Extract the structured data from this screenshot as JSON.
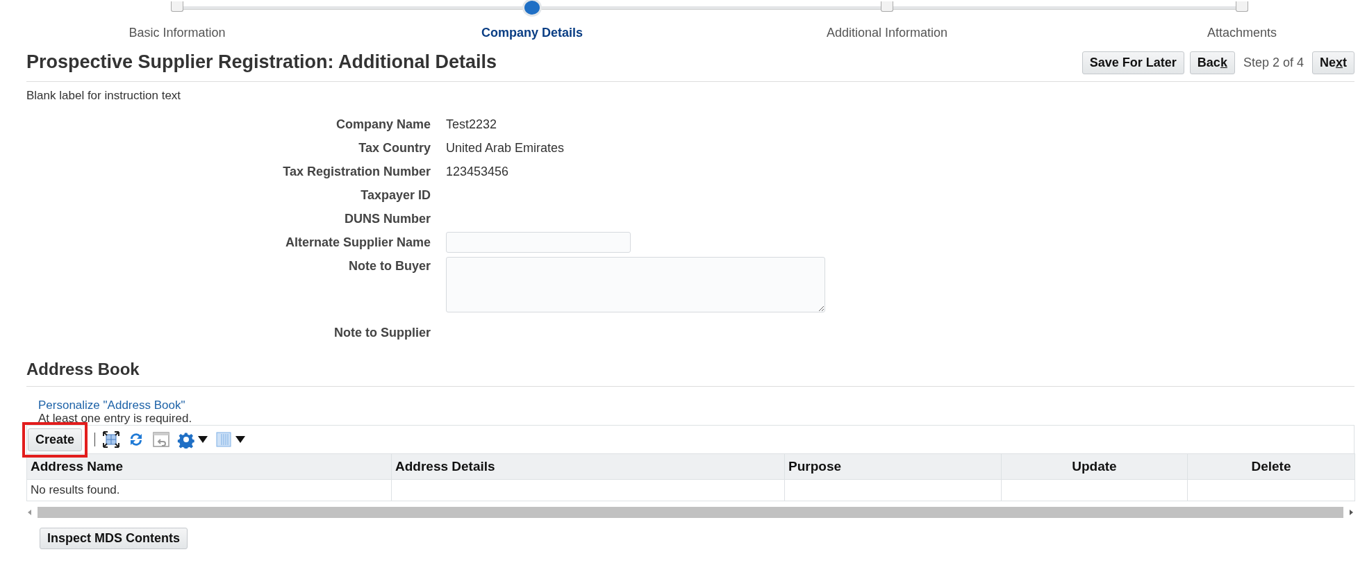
{
  "wizard": {
    "steps": [
      {
        "label": "Basic Information",
        "selected": false
      },
      {
        "label": "Company Details",
        "selected": true
      },
      {
        "label": "Additional Information",
        "selected": false
      },
      {
        "label": "Attachments",
        "selected": false
      }
    ]
  },
  "page_title": "Prospective Supplier Registration: Additional Details",
  "header_actions": {
    "save": {
      "text": "Save For Later"
    },
    "back": {
      "text": "Bac",
      "mnemonic": "k"
    },
    "step_info": "Step 2 of 4",
    "next": {
      "text": "Ne",
      "mnemonic": "x",
      "rest": "t"
    }
  },
  "instruction": "Blank label for instruction text",
  "fields": [
    {
      "kind": "text",
      "label": "Company Name",
      "value": "Test2232"
    },
    {
      "kind": "text",
      "label": "Tax Country",
      "value": "United Arab Emirates"
    },
    {
      "kind": "text",
      "label": "Tax Registration Number",
      "value": "123453456"
    },
    {
      "kind": "text",
      "label": "Taxpayer ID"
    },
    {
      "kind": "text",
      "label": "DUNS Number"
    },
    {
      "kind": "input",
      "label": "Alternate Supplier Name"
    },
    {
      "kind": "textarea",
      "label": "Note to Buyer"
    },
    {
      "kind": "text",
      "label": "Note to Supplier"
    }
  ],
  "address_book": {
    "heading": "Address Book",
    "personalize_link": "Personalize \"Address Book\"",
    "required_note": "At least one entry is required.",
    "create_button": {
      "label": "Create",
      "highlighted": true
    },
    "table": {
      "columns": [
        "Address Name",
        "Address Details",
        "Purpose",
        "Update",
        "Delete"
      ],
      "empty_message": "No results found."
    }
  },
  "inspect_button": "Inspect MDS Contents"
}
